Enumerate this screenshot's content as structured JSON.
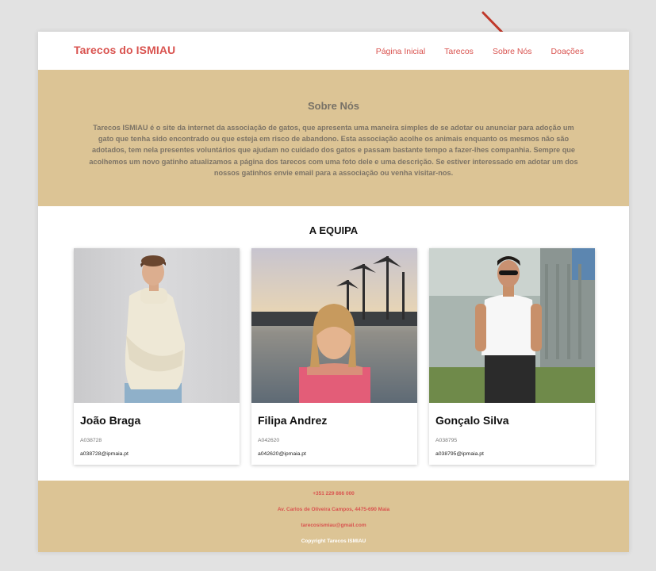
{
  "header": {
    "brand": "Tarecos do ISMIAU",
    "nav": [
      "Página Inicial",
      "Tarecos",
      "Sobre Nós",
      "Doações"
    ]
  },
  "about": {
    "title": "Sobre Nós",
    "text": "Tarecos ISMIAU é o site da internet da associação de gatos, que apresenta uma maneira simples de se adotar ou anunciar para adoção um gato que tenha sido encontrado ou que esteja em risco de abandono. Esta associação acolhe os animais enquanto os mesmos não são adotados, tem nela presentes voluntários que ajudam no cuidado dos gatos e passam bastante tempo a fazer-lhes companhia. Sempre que acolhemos um novo gatinho atualizamos a página dos tarecos com uma foto dele e uma descrição. Se estiver interessado em adotar um dos nossos gatinhos envie email para a associação ou venha visitar-nos."
  },
  "team": {
    "title": "A EQUIPA",
    "members": [
      {
        "name": "João Braga",
        "id": "A038728",
        "email": "a038728@ipmaia.pt"
      },
      {
        "name": "Filipa Andrez",
        "id": "A042620",
        "email": "a042620@ipmaia.pt"
      },
      {
        "name": "Gonçalo Silva",
        "id": "A038795",
        "email": "a038795@ipmaia.pt"
      }
    ]
  },
  "footer": {
    "phone": "+351 229 866 000",
    "address": "Av. Carlos de Oliveira Campos, 4475-690 Maia",
    "email": "tarecosismiau@gmail.com",
    "copyright": "Copyright Tarecos ISMIAU"
  },
  "colors": {
    "accent": "#d9534f",
    "band": "#dcc495",
    "arrow": "#c0392b"
  }
}
